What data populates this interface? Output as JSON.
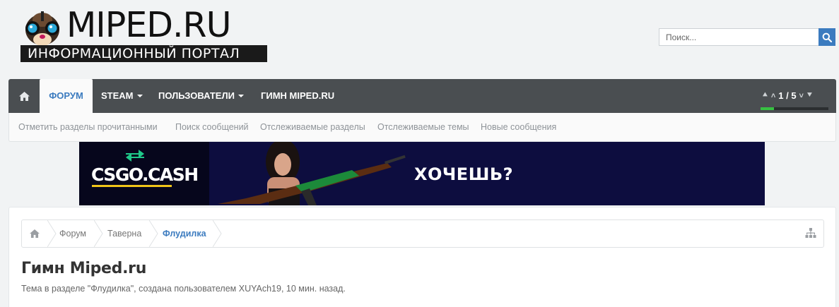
{
  "logo": {
    "title": "MIPED.RU",
    "subtitle": "ИНФОРМАЦИОННЫЙ ПОРТАЛ"
  },
  "search": {
    "placeholder": "Поиск...",
    "icon": "search-icon"
  },
  "nav": {
    "home_icon": "home-icon",
    "tabs": [
      {
        "label": "ФОРУМ",
        "active": true
      },
      {
        "label": "STEAM",
        "dropdown": true
      },
      {
        "label": "ПОЛЬЗОВАТЕЛИ",
        "dropdown": true
      },
      {
        "label": "ГИМН MIPED.RU"
      }
    ],
    "pager": {
      "text": "1 / 5",
      "progress": 0.2
    }
  },
  "subnav": {
    "links": [
      "Отметить разделы прочитанными",
      "Поиск сообщений",
      "Отслеживаемые разделы",
      "Отслеживаемые темы",
      "Новые сообщения"
    ]
  },
  "banner": {
    "brand": "CSGO.CASH",
    "cta": "ХОЧЕШЬ?"
  },
  "breadcrumb": {
    "items": [
      "Форум",
      "Таверна",
      "Флудилка"
    ]
  },
  "thread": {
    "title": "Гимн Miped.ru",
    "meta": "Тема в разделе \"Флудилка\", создана пользователем XUYAch19, 10 мин. назад."
  },
  "colors": {
    "accent": "#3b7bbf",
    "nav_bg": "#4a4e51",
    "progress": "#37c142",
    "banner_bg": "#0d0d3f",
    "banner_underline": "#f0c419"
  }
}
